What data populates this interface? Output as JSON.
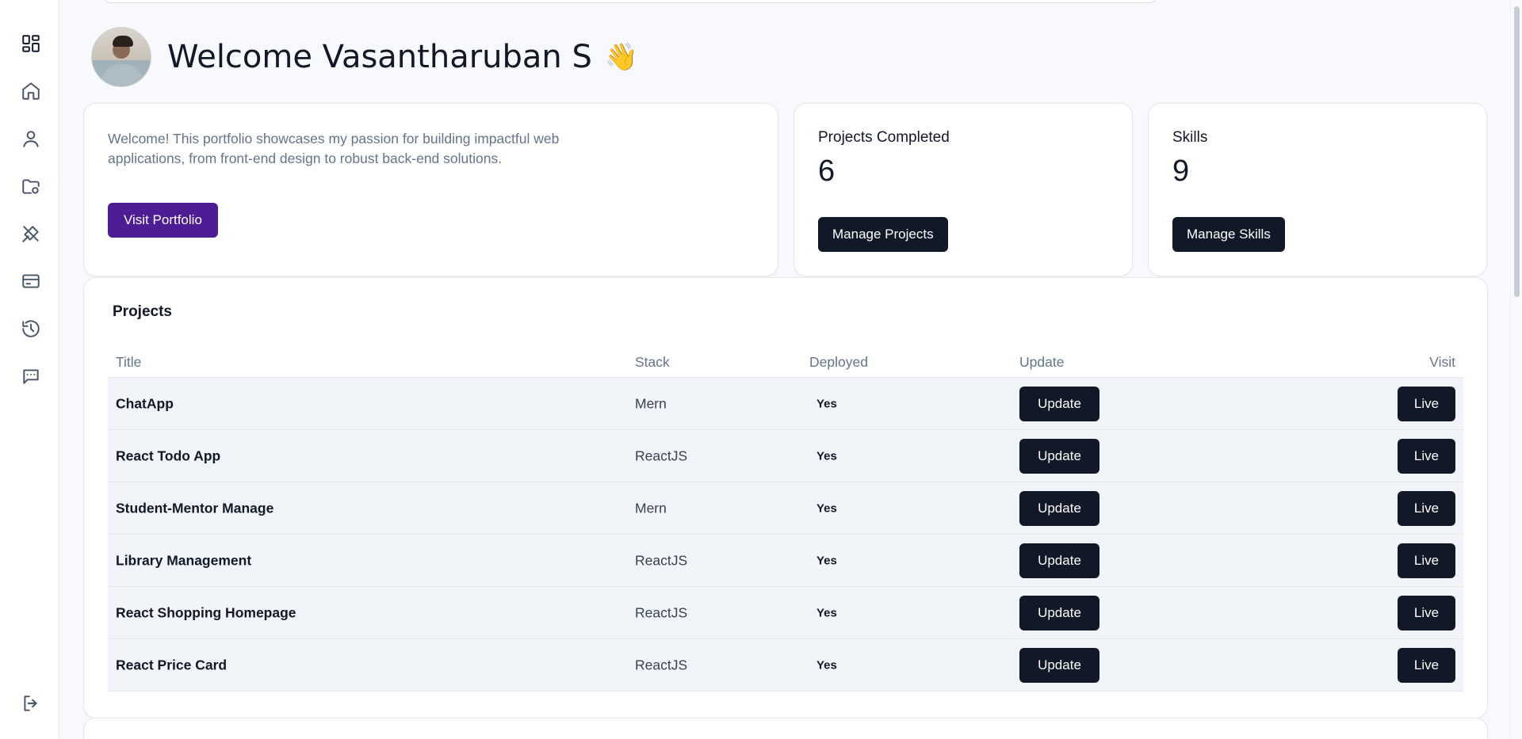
{
  "header": {
    "welcome": "Welcome Vasantharuban S",
    "emoji": "👋"
  },
  "intro": {
    "text": "Welcome! This portfolio showcases my passion for building impactful web applications, from front-end design to robust back-end solutions.",
    "button": "Visit Portfolio"
  },
  "stats": {
    "projects": {
      "label": "Projects Completed",
      "value": "6",
      "button": "Manage Projects"
    },
    "skills": {
      "label": "Skills",
      "value": "9",
      "button": "Manage Skills"
    }
  },
  "projects": {
    "title": "Projects",
    "columns": [
      "Title",
      "Stack",
      "Deployed",
      "Update",
      "Visit"
    ],
    "rows": [
      {
        "title": "ChatApp",
        "stack": "Mern",
        "deployed": "Yes",
        "update": "Update",
        "visit": "Live"
      },
      {
        "title": "React Todo App",
        "stack": "ReactJS",
        "deployed": "Yes",
        "update": "Update",
        "visit": "Live"
      },
      {
        "title": "Student-Mentor Manage",
        "stack": "Mern",
        "deployed": "Yes",
        "update": "Update",
        "visit": "Live"
      },
      {
        "title": "Library Management",
        "stack": "ReactJS",
        "deployed": "Yes",
        "update": "Update",
        "visit": "Live"
      },
      {
        "title": "React Shopping Homepage",
        "stack": "ReactJS",
        "deployed": "Yes",
        "update": "Update",
        "visit": "Live"
      },
      {
        "title": "React Price Card",
        "stack": "ReactJS",
        "deployed": "Yes",
        "update": "Update",
        "visit": "Live"
      }
    ]
  },
  "sidebar": {
    "icons": [
      "dashboard-icon",
      "home-icon",
      "user-icon",
      "folder-settings-icon",
      "tools-icon",
      "card-icon",
      "history-icon",
      "message-icon",
      "logout-icon"
    ]
  },
  "colors": {
    "accent_purple": "#4c1d95",
    "button_dark": "#111827",
    "muted_text": "#64748b",
    "row_bg": "#f1f5f9"
  }
}
